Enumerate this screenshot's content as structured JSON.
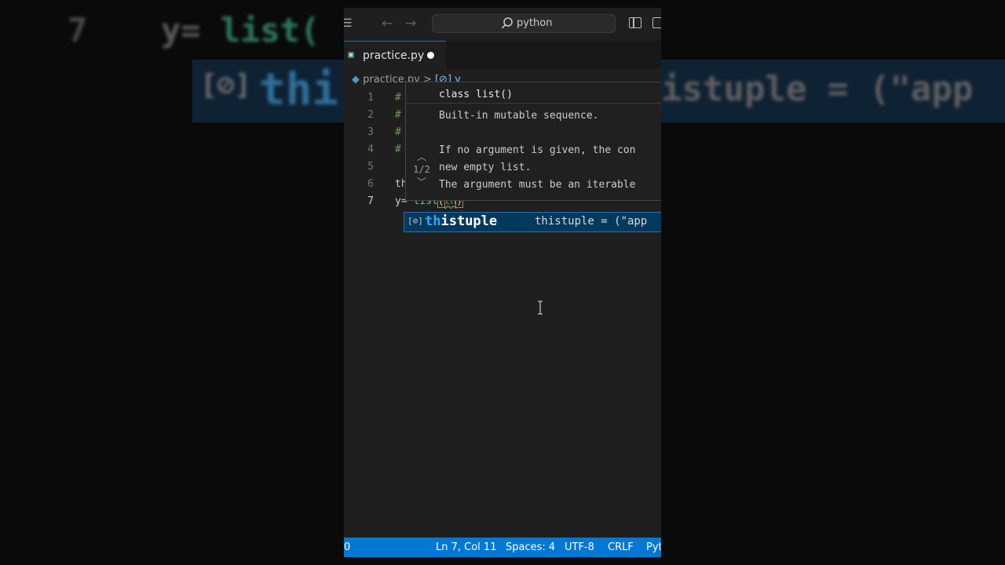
{
  "background": {
    "left_line_number": "7",
    "left_code_prefix": "y= ",
    "left_code_call": "list(",
    "left_symbol": "[⊘]",
    "left_big_text": "thi",
    "right_big_text": "istuple = (\"app"
  },
  "titlebar": {
    "search_text": "python"
  },
  "tab": {
    "file_name": "practice.py"
  },
  "breadcrumb": {
    "file": "practice.py",
    "separator": ">",
    "symbol": "[⊘] y"
  },
  "editor": {
    "lines": [
      {
        "n": "1",
        "text": "#"
      },
      {
        "n": "2",
        "text": "#"
      },
      {
        "n": "3",
        "text": "#"
      },
      {
        "n": "4",
        "text": "#"
      },
      {
        "n": "5",
        "text": ""
      },
      {
        "n": "6",
        "text": "th"
      },
      {
        "n": "7",
        "prefix": "y= ",
        "call": "list",
        "open": "(",
        "arg": "th",
        "close": ")"
      }
    ]
  },
  "hover": {
    "signature": "class list()",
    "lines": [
      "Built-in mutable sequence.",
      "",
      "If no argument is given, the con",
      "new empty list.",
      "The argument must be an iterable"
    ],
    "counter": "1/2"
  },
  "suggestion": {
    "icon": "[⊘]",
    "match": "th",
    "rest": "istuple",
    "detail": "thistuple = (\"app"
  },
  "statusbar": {
    "left": "0",
    "position": "Ln 7, Col 11",
    "spaces": "Spaces: 4",
    "encoding": "UTF-8",
    "eol": "CRLF",
    "language": "Pyt"
  }
}
